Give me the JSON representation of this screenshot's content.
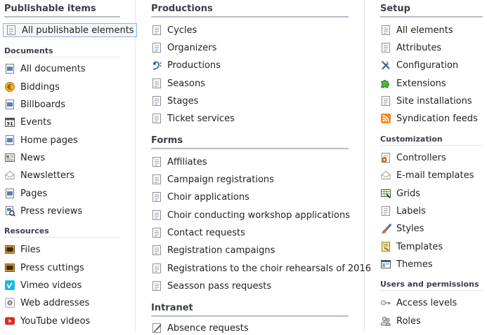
{
  "col1": {
    "publishable": {
      "title": "Publishable items",
      "selected_item": "All publishable elements"
    },
    "documents": {
      "title": "Documents",
      "items": [
        "All documents",
        "Biddings",
        "Billboards",
        "Events",
        "Home pages",
        "News",
        "Newsletters",
        "Pages",
        "Press reviews"
      ]
    },
    "resources": {
      "title": "Resources",
      "items": [
        "Files",
        "Press cuttings",
        "Vimeo videos",
        "Web addresses",
        "YouTube videos"
      ]
    }
  },
  "col2": {
    "productions": {
      "title": "Productions",
      "items": [
        "Cycles",
        "Organizers",
        "Productions",
        "Seasons",
        "Stages",
        "Ticket services"
      ]
    },
    "forms": {
      "title": "Forms",
      "items": [
        "Affiliates",
        "Campaign registrations",
        "Choir applications",
        "Choir conducting workshop applications",
        "Contact requests",
        "Registration campaigns",
        "Registrations to the choir rehearsals of 2016",
        "Seasson pass requests"
      ]
    },
    "intranet": {
      "title": "Intranet",
      "items": [
        "Absence requests"
      ]
    }
  },
  "col3": {
    "setup": {
      "title": "Setup",
      "items": [
        "All elements",
        "Attributes",
        "Configuration",
        "Extensions",
        "Site installations",
        "Syndication feeds"
      ]
    },
    "customization": {
      "title": "Customization",
      "items": [
        "Controllers",
        "E-mail templates",
        "Grids",
        "Labels",
        "Styles",
        "Templates",
        "Themes"
      ]
    },
    "users": {
      "title": "Users and permissions",
      "items": [
        "Access levels",
        "Roles"
      ]
    }
  }
}
